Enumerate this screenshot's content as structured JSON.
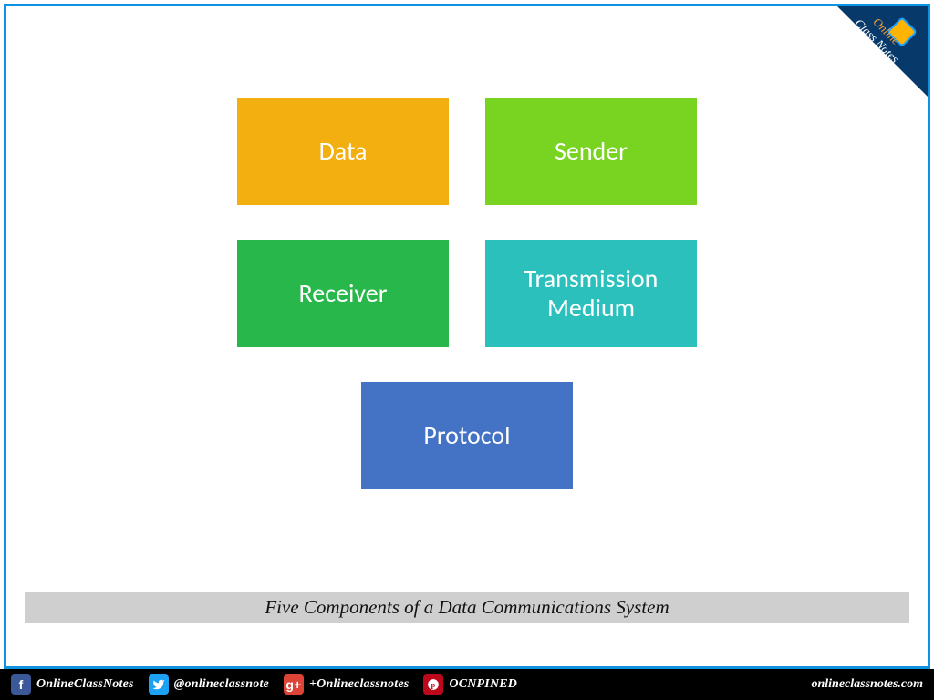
{
  "corner_brand": {
    "line1": "Online",
    "line2": "Class Notes"
  },
  "boxes": {
    "data": "Data",
    "sender": "Sender",
    "receiver": "Receiver",
    "transmission": "Transmission Medium",
    "protocol": "Protocol"
  },
  "caption": "Five Components of a Data Communications System",
  "footer": {
    "facebook": "OnlineClassNotes",
    "twitter": "@onlineclassnote",
    "gplus": "+Onlineclassnotes",
    "pinterest": "OCNPINED",
    "site": "onlineclassnotes.com"
  },
  "colors": {
    "frame_border": "#0d93e2",
    "data": "#f3ae0f",
    "sender": "#79d321",
    "receiver": "#28b74a",
    "transmission": "#2cc0bd",
    "protocol": "#4472c4"
  }
}
